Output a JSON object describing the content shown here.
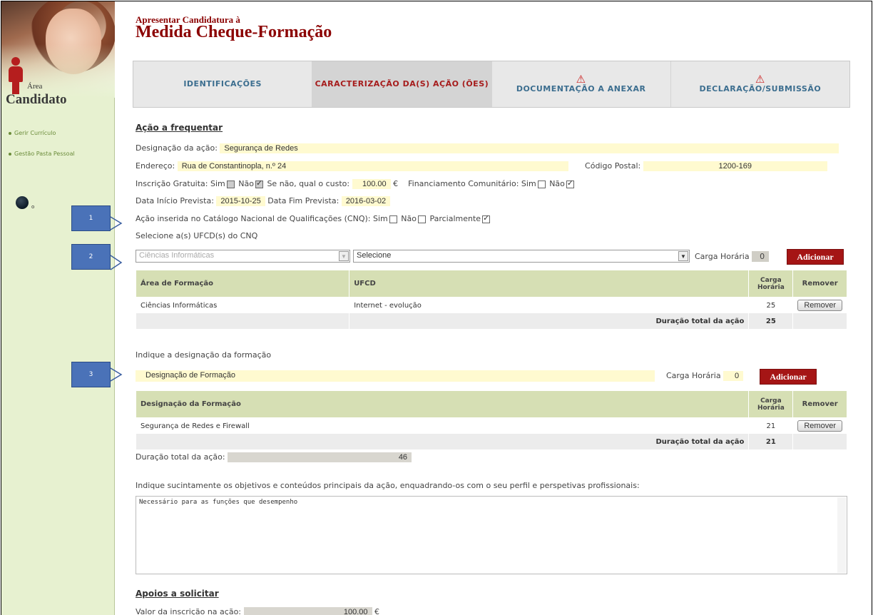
{
  "sidebar": {
    "area_label": "Área",
    "area_title": "Candidato",
    "links": [
      "Gerir Currículo",
      "Gestão Pasta Pessoal"
    ],
    "globe_suffix": "o"
  },
  "header": {
    "title_small": "Apresentar Candidatura à",
    "title_big": "Medida Cheque-Formação"
  },
  "tabs": [
    {
      "label": "IDENTIFICAÇÕES",
      "active": false,
      "warning": false
    },
    {
      "label": "CARACTERIZAÇÃO DA(S) AÇÃO (ÕES)",
      "active": true,
      "warning": false
    },
    {
      "label": "DOCUMENTAÇÃO A ANEXAR",
      "active": false,
      "warning": true
    },
    {
      "label": "DECLARAÇÃO/SUBMISSÃO",
      "active": false,
      "warning": true
    }
  ],
  "acao": {
    "section_title": "Ação a frequentar",
    "designacao_label": "Designação da ação:",
    "designacao_value": "Segurança de Redes",
    "endereco_label": "Endereço:",
    "endereco_value": "Rua de Constantinopla, n.º 24",
    "codigo_postal_label": "Código Postal:",
    "codigo_postal_value": "1200-169",
    "inscricao_label": "Inscrição Gratuita:",
    "sim": "Sim",
    "nao": "Não",
    "custo_label": "Se não, qual o custo:",
    "custo_value": "100.00",
    "euro": "€",
    "financiamento_label": "Financiamento Comunitário:",
    "data_inicio_label": "Data Início Prevista:",
    "data_inicio_value": "2015-10-25",
    "data_fim_label": "Data Fim Prevista:",
    "data_fim_value": "2016-03-02",
    "cnq_label": "Ação inserida no Catálogo Nacional de Qualificações (CNQ):",
    "parcialmente": "Parcialmente",
    "selecione_label": "Selecione a(s) UFCD(s) do CNQ",
    "select_area_value": "Ciências Informáticas",
    "select_ufcd_value": "Selecione",
    "carga_horaria_label": "Carga Horária",
    "carga_horaria_value": "0",
    "adicionar": "Adicionar"
  },
  "ufcd_table": {
    "headers": [
      "Área de Formação",
      "UFCD",
      "Carga Horária",
      "Remover"
    ],
    "rows": [
      {
        "area": "Ciências Informáticas",
        "ufcd": "Internet - evolução",
        "carga": "25",
        "remover": "Remover"
      }
    ],
    "total_label": "Duração total da ação",
    "total_value": "25"
  },
  "formacao": {
    "label": "Indique a designação da formação",
    "input_placeholder": "Designação de Formação",
    "carga_horaria_label": "Carga Horária",
    "carga_horaria_value": "0",
    "adicionar": "Adicionar"
  },
  "formacao_table": {
    "headers": [
      "Designação da Formação",
      "Carga Horária",
      "Remover"
    ],
    "rows": [
      {
        "designacao": "Segurança de Redes e Firewall",
        "carga": "21",
        "remover": "Remover"
      }
    ],
    "total_label": "Duração total da ação",
    "total_value": "21"
  },
  "duracao_total": {
    "label": "Duração total da ação:",
    "value": "46"
  },
  "objetivos": {
    "label": "Indique sucintamente os objetivos e conteúdos principais da ação, enquadrando-os com o seu perfil e perspetivas profissionais:",
    "value": "Necessário para as funções que desempenho"
  },
  "apoios": {
    "section_title": "Apoios a solicitar",
    "valor_label": "Valor da inscrição na ação:",
    "valor_value": "100.00",
    "euro": "€"
  },
  "callouts": [
    "1",
    "2",
    "3"
  ]
}
